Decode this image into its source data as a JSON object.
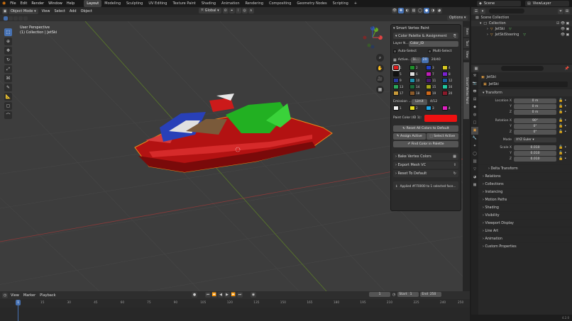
{
  "menu": [
    "File",
    "Edit",
    "Render",
    "Window",
    "Help"
  ],
  "workspaces": [
    "Layout",
    "Modeling",
    "Sculpting",
    "UV Editing",
    "Texture Paint",
    "Shading",
    "Animation",
    "Rendering",
    "Compositing",
    "Geometry Nodes",
    "Scripting"
  ],
  "active_workspace": "Layout",
  "scene_name": "Scene",
  "view_layer": "ViewLayer",
  "viewport_header": {
    "mode": "Object Mode",
    "menus": [
      "View",
      "Select",
      "Add",
      "Object"
    ],
    "transform": "Global",
    "options": "Options"
  },
  "viewport": {
    "perspective": "User Perspective",
    "collection": "(1) Collection | JetSki"
  },
  "gizmo": {
    "x": "X",
    "y": "Y",
    "z": "Z"
  },
  "side_tabs": [
    "Item",
    "Tool",
    "View",
    "Smart Vertex Paint"
  ],
  "smart_panel": {
    "title": "Smart Vertex Paint",
    "sub_title": "Color Palette & Assignment",
    "layer_label": "Layer N...",
    "layer_value": "Color_ID",
    "auto_select": "Auto-Select",
    "multi_select": "Multi-Select",
    "active_label": "Active...",
    "active_btn1": "1i...",
    "active_btn2": "20",
    "active_count": "20/40",
    "palette": [
      {
        "n": "1",
        "c": "#e01b1b"
      },
      {
        "n": "2",
        "c": "#1f8f2a"
      },
      {
        "n": "3",
        "c": "#2342c8"
      },
      {
        "n": "4",
        "c": "#d8c820"
      },
      {
        "n": "5",
        "c": "#111111"
      },
      {
        "n": "6",
        "c": "#e0e0e0"
      },
      {
        "n": "7",
        "c": "#c01fb8"
      },
      {
        "n": "8",
        "c": "#7a22d0"
      },
      {
        "n": "9",
        "c": "#2a3a9a"
      },
      {
        "n": "10",
        "c": "#1e8ea8"
      },
      {
        "n": "11",
        "c": "#4a1a70"
      },
      {
        "n": "12",
        "c": "#1a5a9a"
      },
      {
        "n": "13",
        "c": "#2aa85a"
      },
      {
        "n": "14",
        "c": "#1a6a3a"
      },
      {
        "n": "15",
        "c": "#a8a81a"
      },
      {
        "n": "16",
        "c": "#20c8a0"
      },
      {
        "n": "17",
        "c": "#c89a3a"
      },
      {
        "n": "18",
        "c": "#8a5a2a"
      },
      {
        "n": "19",
        "c": "#d06a1a"
      },
      {
        "n": "20",
        "c": "#8a1a2a"
      }
    ],
    "emission_label": "Emission ...",
    "emission_btn": "Limit",
    "emission_count": "4/12",
    "emission": [
      {
        "n": "1",
        "c": "#f0f0f0"
      },
      {
        "n": "2",
        "c": "#e8e020"
      },
      {
        "n": "3",
        "c": "#20a8e8"
      },
      {
        "n": "4",
        "c": "#e020c0"
      }
    ],
    "paint_color_label": "Paint Color (ID 1):",
    "paint_color": "#ee1111",
    "reset_all": "Reset All Colors to Default",
    "assign_active": "Assign Active",
    "select_active": "Select Active",
    "find_color": "Find Color in Palette",
    "bake": "Bake Vertex Colors",
    "export": "Export Mesh VC",
    "reset_default": "Reset To Default",
    "status": "Applied #FF0000 to 1 selected face..."
  },
  "outliner": {
    "root": "Scene Collection",
    "collection": "Collection",
    "items": [
      "JetSki",
      "JetSkiSteering"
    ]
  },
  "properties": {
    "object_name": "JetSki",
    "object_field": "JetSki",
    "transform": "Transform",
    "location": {
      "label": "Location X",
      "x": "0 m",
      "y": "0 m",
      "z": "0 m"
    },
    "rotation": {
      "label": "Rotation X",
      "x": "90°",
      "y": "0°",
      "z": "0°"
    },
    "mode_label": "Mode",
    "mode": "XYZ Euler",
    "scale": {
      "label": "Scale X",
      "x": "0.010",
      "y": "0.010",
      "z": "0.010"
    },
    "axis_y": "Y",
    "axis_z": "Z",
    "delta": "Delta Transform",
    "sections": [
      "Relations",
      "Collections",
      "Instancing",
      "Motion Paths",
      "Shading",
      "Visibility",
      "Viewport Display",
      "Line Art",
      "Animation",
      "Custom Properties"
    ]
  },
  "timeline": {
    "menus": [
      "View",
      "Marker",
      "Playback"
    ],
    "current": "1",
    "start_label": "Start",
    "start": "1",
    "end_label": "End",
    "end": "250",
    "ticks": [
      "1",
      "15",
      "30",
      "45",
      "60",
      "75",
      "90",
      "105",
      "120",
      "135",
      "150",
      "165",
      "180",
      "195",
      "210",
      "225",
      "240",
      "250"
    ],
    "version": "4.2.0"
  }
}
